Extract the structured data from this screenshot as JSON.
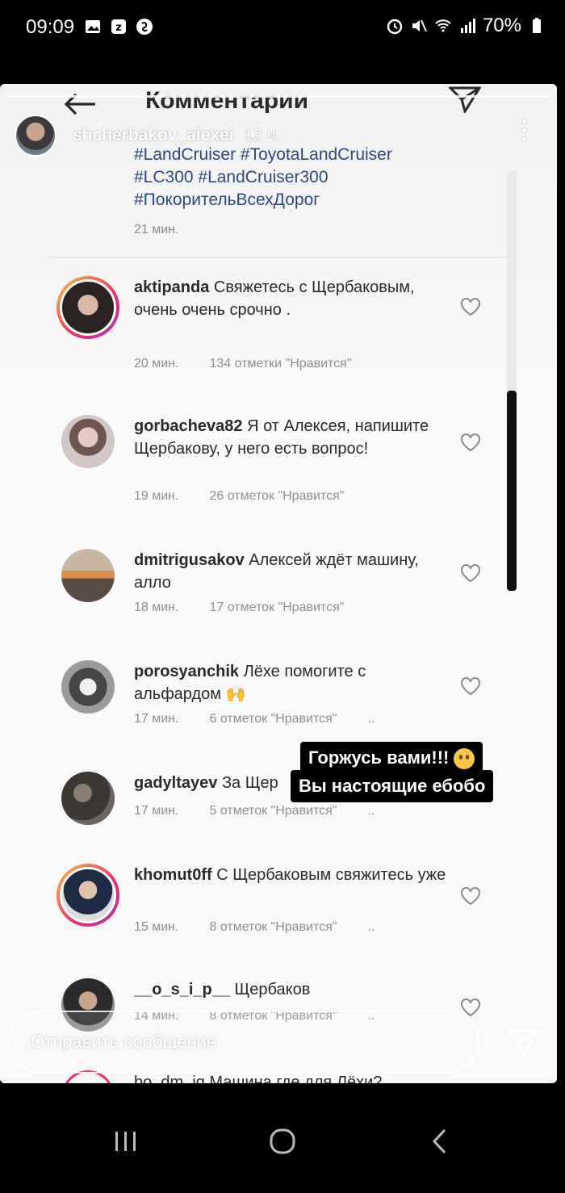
{
  "status_bar": {
    "time": "09:09",
    "battery": "70%",
    "left_icons": [
      "image-icon",
      "alarm-badge-icon",
      "shazam-icon"
    ],
    "right_icons": [
      "alarm-icon",
      "mute-icon",
      "wifi-icon",
      "signal-icon",
      "battery-icon"
    ]
  },
  "header": {
    "title": "Комментарии",
    "back_icon": "back-arrow-icon",
    "send_icon": "paper-plane-icon"
  },
  "story": {
    "username": "shcherbakov_alexei",
    "time_ago": "12 ч."
  },
  "caption": {
    "lines": [
      "#LandCruiser #ToyotaLandCruiser",
      "#LC300 #LandCruiser300",
      "#ПокорительВсехДорог"
    ],
    "time": "21 мин."
  },
  "comments": [
    {
      "user": "aktipanda",
      "text": "Свяжетесь с Щербаковым, очень очень срочно .",
      "time": "20 мин.",
      "likes": "134 отметки \"Нравится\"",
      "dots": "",
      "ring": true,
      "avatar_color": "#3a2f2c"
    },
    {
      "user": "gorbacheva82",
      "text": "Я от Алексея, напишите Щербакову, у него есть вопрос!",
      "time": "19 мин.",
      "likes": "26 отметок \"Нравится\"",
      "dots": "",
      "ring": false,
      "avatar_color": "#c8b8b4"
    },
    {
      "user": "dmitrigusakov",
      "text": "Алексей ждёт машину, алло",
      "time": "18 мин.",
      "likes": "17 отметок \"Нравится\"",
      "dots": "",
      "ring": false,
      "avatar_color": "#8a7a6e"
    },
    {
      "user": "porosyanchik",
      "text": "Лёхе помогите с альфардом 🙌",
      "time": "17 мин.",
      "likes": "6 отметок \"Нравится\"",
      "dots": "..",
      "ring": false,
      "avatar_color": "#6f6f6f"
    },
    {
      "user": "gadyltayev",
      "text": "За Щер",
      "time": "17 мин.",
      "likes": "5 отметок \"Нравится\"",
      "dots": "..",
      "ring": false,
      "avatar_color": "#4a4540"
    },
    {
      "user": "khomut0ff",
      "text": "С Щербаковым свяжитесь уже",
      "time": "15 мин.",
      "likes": "8 отметок \"Нравится\"",
      "dots": "..",
      "ring": true,
      "avatar_color": "#2f3b52"
    },
    {
      "user": "__o_s_i_p__",
      "text": "Щербаков",
      "time": "14 мин.",
      "likes": "8 отметок \"Нравится\"",
      "dots": "..",
      "ring": false,
      "avatar_color": "#3a3a3a"
    }
  ],
  "peek_comment": "bo_dm_iq Машина где для Лёхи?",
  "sticker": {
    "line1": "Горжусь вами!!!",
    "line2": "Вы настоящие ебобо",
    "emoji": "smiling-face-with-tear"
  },
  "reply": {
    "placeholder": "Отправить сообщение"
  },
  "nav": {
    "buttons": [
      "recent-apps-icon",
      "home-icon",
      "back-icon"
    ]
  }
}
